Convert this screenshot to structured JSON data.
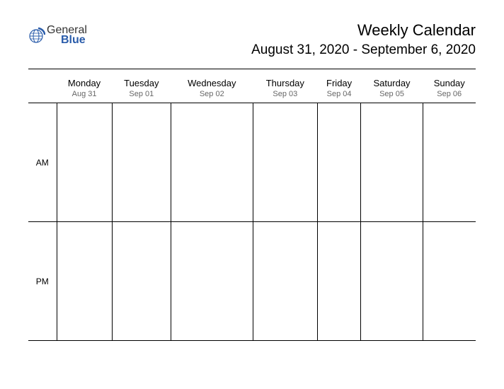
{
  "logo": {
    "text_top": "General",
    "text_bottom": "Blue",
    "accent_color": "#2a5caa"
  },
  "header": {
    "title": "Weekly Calendar",
    "date_range": "August 31, 2020 - September 6, 2020"
  },
  "periods": {
    "am": "AM",
    "pm": "PM"
  },
  "days": [
    {
      "name": "Monday",
      "date": "Aug 31"
    },
    {
      "name": "Tuesday",
      "date": "Sep 01"
    },
    {
      "name": "Wednesday",
      "date": "Sep 02"
    },
    {
      "name": "Thursday",
      "date": "Sep 03"
    },
    {
      "name": "Friday",
      "date": "Sep 04"
    },
    {
      "name": "Saturday",
      "date": "Sep 05"
    },
    {
      "name": "Sunday",
      "date": "Sep 06"
    }
  ]
}
